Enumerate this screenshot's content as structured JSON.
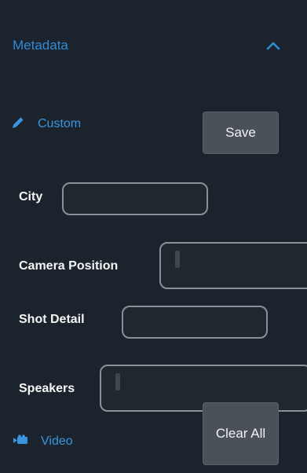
{
  "metadata": {
    "title": "Metadata",
    "collapse_icon": "chevron-up-icon",
    "accent_color": "#2f8cd6"
  },
  "custom": {
    "label": "Custom",
    "icon": "pencil-icon",
    "save_label": "Save"
  },
  "fields": {
    "city": {
      "label": "City",
      "value": ""
    },
    "camera_position": {
      "label": "Camera Position",
      "value": ""
    },
    "shot_detail": {
      "label": "Shot Detail",
      "value": ""
    },
    "speakers": {
      "label": "Speakers",
      "value": ""
    }
  },
  "video": {
    "label": "Video",
    "icon": "video-camera-icon"
  },
  "actions": {
    "clear_all_label": "Clear All"
  }
}
